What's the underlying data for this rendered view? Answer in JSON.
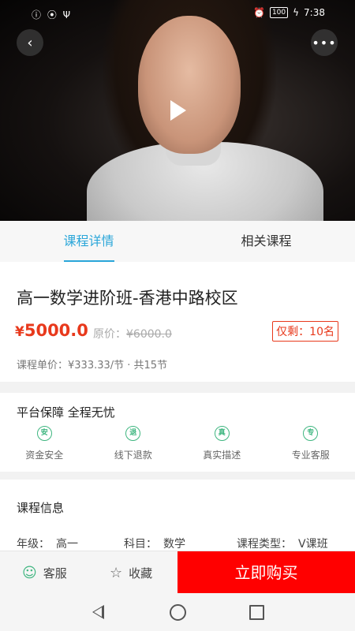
{
  "status_bar": {
    "left_icons": "ⓘ ⦿ Ψ",
    "alarm_icon": "⏰",
    "battery": "100",
    "charging_icon": "ϟ",
    "time": "7:38"
  },
  "video": {
    "back_icon": "‹",
    "more_icon": "•••"
  },
  "tabs": [
    {
      "label": "课程详情",
      "active": true
    },
    {
      "label": "相关课程",
      "active": false
    }
  ],
  "course": {
    "title": "高一数学进阶班-香港中路校区",
    "price_symbol": "¥",
    "price": "5000.0",
    "original_label": "原价：",
    "original_price": "¥6000.0",
    "remaining": "仅剩：10名",
    "unit_price": "课程单价：¥333.33/节 · 共15节"
  },
  "guarantee": {
    "title": "平台保障 全程无忧",
    "items": [
      {
        "icon": "安",
        "label": "资金安全"
      },
      {
        "icon": "退",
        "label": "线下退款"
      },
      {
        "icon": "真",
        "label": "真实描述"
      },
      {
        "icon": "专",
        "label": "专业客服"
      }
    ]
  },
  "info": {
    "title": "课程信息",
    "grade_key": "年级：",
    "grade_val": "高一",
    "subject_key": "科目：",
    "subject_val": "数学",
    "type_key": "课程类型：",
    "type_val": "V课班"
  },
  "bottom": {
    "service_label": "客服",
    "service_icon": "☺",
    "fav_label": "收藏",
    "fav_icon": "☆",
    "buy_label": "立即购买"
  },
  "colors": {
    "accent": "#2aa6d9",
    "price": "#e8391c",
    "buy": "#ff0000",
    "guarantee": "#3fb680"
  }
}
